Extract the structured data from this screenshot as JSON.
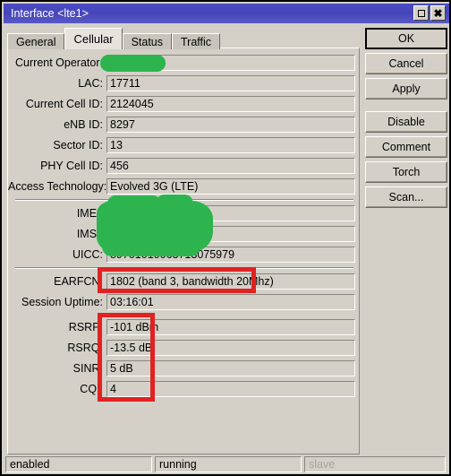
{
  "window": {
    "title": "Interface <lte1>",
    "title_bar_color": "#4646b8",
    "maximize_icon": "maximize-icon",
    "close_icon": "close-icon"
  },
  "tabs": [
    {
      "label": "General",
      "active": false
    },
    {
      "label": "Cellular",
      "active": true
    },
    {
      "label": "Status",
      "active": false
    },
    {
      "label": "Traffic",
      "active": false
    }
  ],
  "fields": [
    {
      "label": "Current Operator:",
      "value": "",
      "redacted": true
    },
    {
      "label": "LAC:",
      "value": "17711"
    },
    {
      "label": "Current Cell ID:",
      "value": "2124045"
    },
    {
      "label": "eNB ID:",
      "value": "8297"
    },
    {
      "label": "Sector ID:",
      "value": "13"
    },
    {
      "label": "PHY Cell ID:",
      "value": "456"
    },
    {
      "label": "Access Technology:",
      "value": "Evolved 3G (LTE)"
    },
    {
      "label": "IMEI:",
      "value": "",
      "redacted": true
    },
    {
      "label": "IMSI:",
      "value": "",
      "redacted": true
    },
    {
      "label": "UICC:",
      "value": "89701010063713075979"
    },
    {
      "label": "EARFCN:",
      "value": "1802 (band 3, bandwidth 20Mhz)",
      "highlighted": true
    },
    {
      "label": "Session Uptime:",
      "value": "03:16:01"
    },
    {
      "label": "RSRP:",
      "value": "-101 dBm",
      "highlighted": true
    },
    {
      "label": "RSRQ:",
      "value": "-13.5 dB",
      "highlighted": true
    },
    {
      "label": "SINR:",
      "value": "5 dB",
      "highlighted": true
    },
    {
      "label": "CQI:",
      "value": "4",
      "highlighted": true
    }
  ],
  "buttons": [
    {
      "label": "OK",
      "default": true
    },
    {
      "label": "Cancel",
      "default": false
    },
    {
      "label": "Apply",
      "default": false
    },
    {
      "label": "Disable",
      "default": false
    },
    {
      "label": "Comment",
      "default": false
    },
    {
      "label": "Torch",
      "default": false
    },
    {
      "label": "Scan...",
      "default": false
    }
  ],
  "statusbar": [
    {
      "text": "enabled",
      "disabled": false
    },
    {
      "text": "running",
      "disabled": false
    },
    {
      "text": "slave",
      "disabled": true
    }
  ],
  "annotations": {
    "redaction_color": "#2eb44e",
    "highlight_color": "#e02222"
  }
}
